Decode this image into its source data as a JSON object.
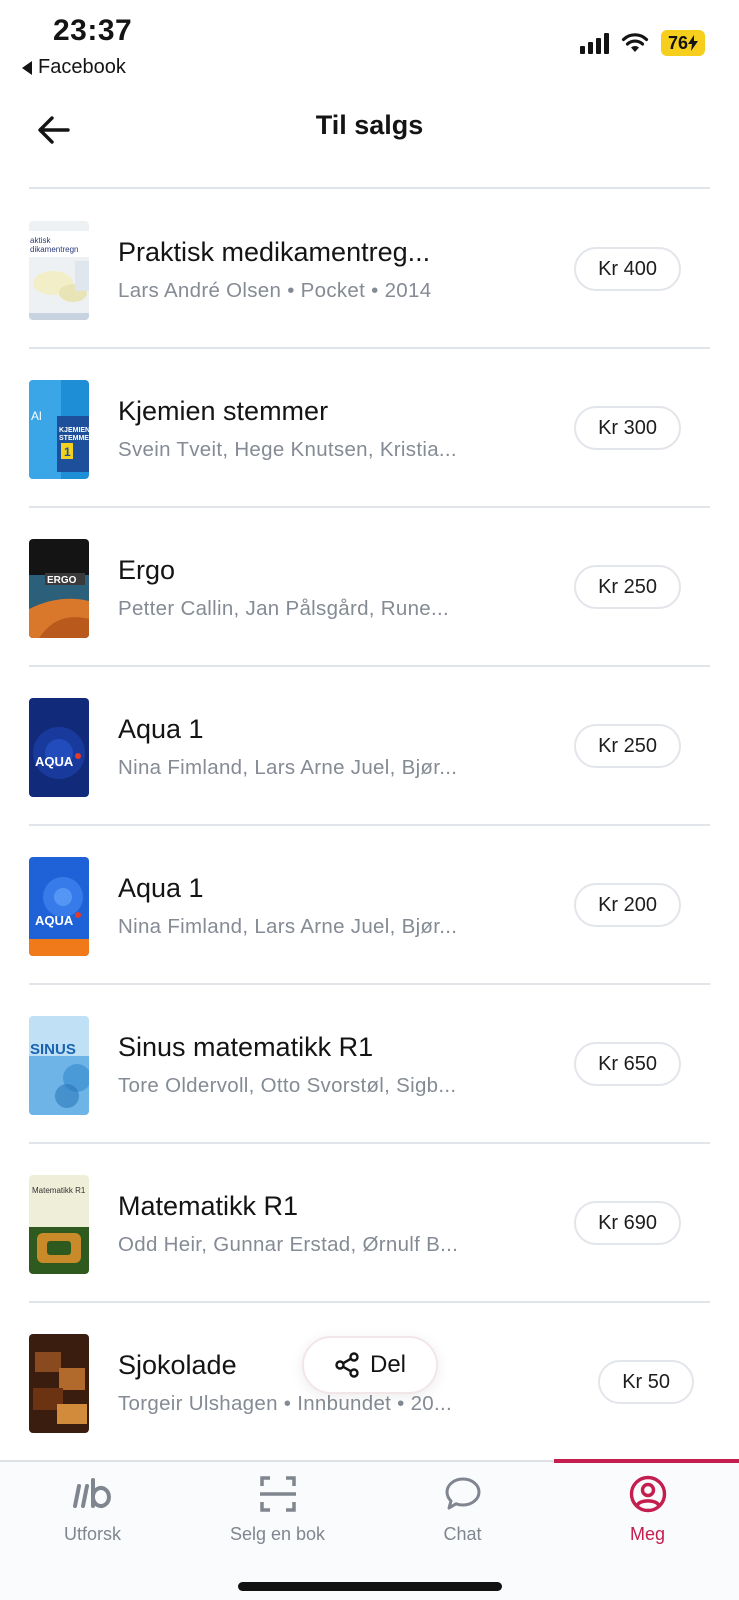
{
  "status_bar": {
    "time": "23:37",
    "back_app": "Facebook",
    "battery": "76"
  },
  "header": {
    "title": "Til salgs"
  },
  "listings": [
    {
      "title": "Praktisk medikamentreg...",
      "subtitle": "Lars André Olsen • Pocket • 2014",
      "price": "Kr 400"
    },
    {
      "title": "Kjemien stemmer",
      "subtitle": "Svein Tveit, Hege Knutsen, Kristia...",
      "price": "Kr 300"
    },
    {
      "title": "Ergo",
      "subtitle": "Petter Callin, Jan Pålsgård, Rune...",
      "price": "Kr 250"
    },
    {
      "title": "Aqua 1",
      "subtitle": "Nina Fimland, Lars Arne Juel, Bjør...",
      "price": "Kr 250"
    },
    {
      "title": "Aqua 1",
      "subtitle": "Nina Fimland, Lars Arne Juel, Bjør...",
      "price": "Kr 200"
    },
    {
      "title": "Sinus matematikk R1",
      "subtitle": "Tore Oldervoll, Otto Svorstøl, Sigb...",
      "price": "Kr 650"
    },
    {
      "title": "Matematikk R1",
      "subtitle": "Odd Heir, Gunnar Erstad, Ørnulf B...",
      "price": "Kr 690"
    },
    {
      "title": "Sjokolade",
      "subtitle": "Torgeir Ulshagen • Innbundet • 20...",
      "price": "Kr 50"
    }
  ],
  "share_button": {
    "label": "Del"
  },
  "tabs": [
    {
      "label": "Utforsk",
      "icon": "explore-icon"
    },
    {
      "label": "Selg en bok",
      "icon": "scan-icon"
    },
    {
      "label": "Chat",
      "icon": "chat-icon"
    },
    {
      "label": "Meg",
      "icon": "profile-icon"
    }
  ],
  "colors": {
    "accent": "#c41e4f",
    "battery": "#f6cf1e",
    "muted_text": "#858b94",
    "divider": "#e1e5ea"
  }
}
